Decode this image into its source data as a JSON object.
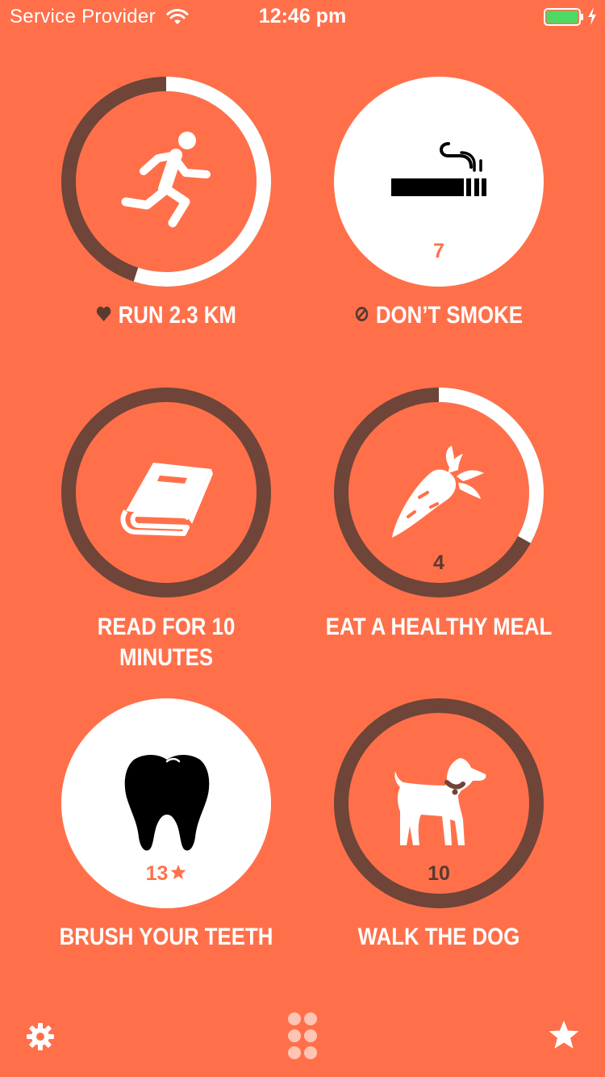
{
  "status_bar": {
    "carrier": "Service Provider",
    "time": "12:46 pm",
    "wifi_icon": "wifi-icon",
    "battery_icon": "battery-charging-icon",
    "battery_level": 1.0
  },
  "colors": {
    "background": "#FF704A",
    "ring_track": "#6E4538",
    "ring_progress": "#FFFFFF",
    "white": "#FFFFFF",
    "accent_text": "#FF704A",
    "dark_text": "#5A3A30",
    "battery_fill": "#4CD964"
  },
  "habits": [
    {
      "id": "run",
      "label_icon": "heart-icon",
      "label": "RUN 2.3 KM",
      "icon": "runner-icon",
      "count": "",
      "state": "progress",
      "progress": 0.55
    },
    {
      "id": "smoke",
      "label_icon": "no-sign-icon",
      "label": "DON’T SMOKE",
      "icon": "cigarette-icon",
      "count": "7",
      "state": "complete",
      "progress": 1.0
    },
    {
      "id": "read",
      "label_icon": "",
      "label": "READ FOR 10 MINUTES",
      "icon": "book-icon",
      "count": "",
      "state": "empty",
      "progress": 0
    },
    {
      "id": "meal",
      "label_icon": "",
      "label": "EAT A HEALTHY MEAL",
      "icon": "carrot-icon",
      "count": "4",
      "state": "progress",
      "progress": 0.33
    },
    {
      "id": "teeth",
      "label_icon": "",
      "label": "BRUSH YOUR TEETH",
      "icon": "tooth-icon",
      "count": "13",
      "count_icon": "star-icon",
      "state": "complete",
      "progress": 1.0
    },
    {
      "id": "dog",
      "label_icon": "",
      "label": "WALK THE DOG",
      "icon": "dog-icon",
      "count": "10",
      "state": "empty",
      "progress": 0
    }
  ],
  "tabbar": {
    "items": [
      {
        "icon": "gear-icon",
        "name": "settings-tab"
      },
      {
        "icon": "grid-dots-icon",
        "name": "habits-tab"
      },
      {
        "icon": "star-icon",
        "name": "favorites-tab"
      }
    ]
  }
}
